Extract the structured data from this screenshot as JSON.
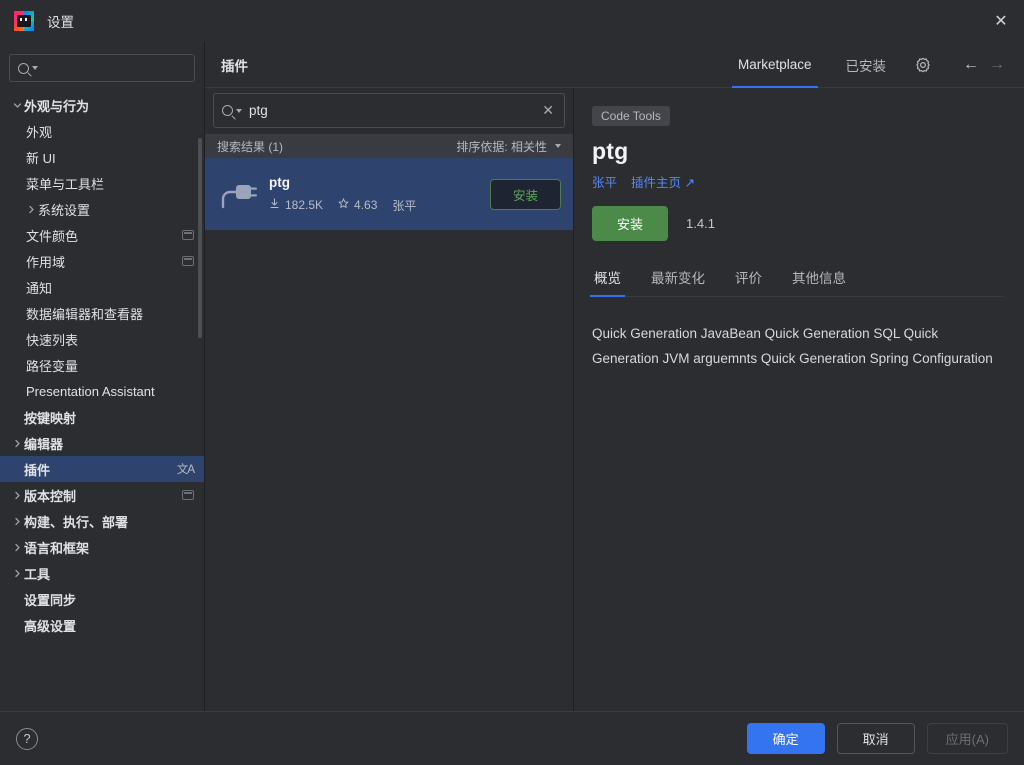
{
  "window": {
    "title": "设置",
    "logo_icon": "intellij-idea-logo",
    "close_icon": "close-icon"
  },
  "sidebar": {
    "search": {
      "value": "",
      "placeholder": "",
      "icon": "search-icon",
      "dropdown_icon": "chevron-down-icon"
    },
    "items": [
      {
        "label": "外观与行为",
        "level": 0,
        "arrow": "expanded",
        "selected": false,
        "badge": null
      },
      {
        "label": "外观",
        "level": 1,
        "arrow": null,
        "selected": false,
        "badge": null
      },
      {
        "label": "新 UI",
        "level": 1,
        "arrow": null,
        "selected": false,
        "badge": null
      },
      {
        "label": "菜单与工具栏",
        "level": 1,
        "arrow": null,
        "selected": false,
        "badge": null
      },
      {
        "label": "系统设置",
        "level": 1,
        "arrow": "collapsed",
        "selected": false,
        "badge": null
      },
      {
        "label": "文件颜色",
        "level": 1,
        "arrow": null,
        "selected": false,
        "badge": "project-icon"
      },
      {
        "label": "作用域",
        "level": 1,
        "arrow": null,
        "selected": false,
        "badge": "project-icon"
      },
      {
        "label": "通知",
        "level": 1,
        "arrow": null,
        "selected": false,
        "badge": null
      },
      {
        "label": "数据编辑器和查看器",
        "level": 1,
        "arrow": null,
        "selected": false,
        "badge": null
      },
      {
        "label": "快速列表",
        "level": 1,
        "arrow": null,
        "selected": false,
        "badge": null
      },
      {
        "label": "路径变量",
        "level": 1,
        "arrow": null,
        "selected": false,
        "badge": null
      },
      {
        "label": "Presentation Assistant",
        "level": 1,
        "arrow": null,
        "selected": false,
        "badge": null
      },
      {
        "label": "按键映射",
        "level": 0,
        "arrow": null,
        "selected": false,
        "badge": null
      },
      {
        "label": "编辑器",
        "level": 0,
        "arrow": "collapsed",
        "selected": false,
        "badge": null
      },
      {
        "label": "插件",
        "level": 0,
        "arrow": null,
        "selected": true,
        "badge": "translate-icon"
      },
      {
        "label": "版本控制",
        "level": 0,
        "arrow": "collapsed",
        "selected": false,
        "badge": "project-icon"
      },
      {
        "label": "构建、执行、部署",
        "level": 0,
        "arrow": "collapsed",
        "selected": false,
        "badge": null
      },
      {
        "label": "语言和框架",
        "level": 0,
        "arrow": "collapsed",
        "selected": false,
        "badge": null
      },
      {
        "label": "工具",
        "level": 0,
        "arrow": "collapsed",
        "selected": false,
        "badge": null
      },
      {
        "label": "设置同步",
        "level": 0,
        "arrow": null,
        "selected": false,
        "badge": null
      },
      {
        "label": "高级设置",
        "level": 0,
        "arrow": null,
        "selected": false,
        "badge": null
      }
    ]
  },
  "plugins": {
    "title": "插件",
    "tabs": [
      {
        "label": "Marketplace",
        "active": true
      },
      {
        "label": "已安装",
        "active": false
      }
    ],
    "gear_icon": "gear-icon",
    "nav": {
      "back_icon": "arrow-left-icon",
      "forward_icon": "arrow-right-icon"
    },
    "search": {
      "value": "ptg",
      "placeholder": "",
      "icon": "search-icon",
      "dropdown_icon": "chevron-down-icon",
      "clear_icon": "clear-icon"
    },
    "results_label": "搜索结果 (1)",
    "sort_label": "排序依据: 相关性",
    "sort_icon": "chevron-down-icon",
    "list": [
      {
        "icon": "plug-icon",
        "name": "ptg",
        "downloads_icon": "download-icon",
        "downloads": "182.5K",
        "rating_icon": "star-icon",
        "rating": "4.63",
        "author": "张平",
        "install_label": "安装",
        "selected": true
      }
    ]
  },
  "detail": {
    "tag": "Code Tools",
    "title": "ptg",
    "author_link": "张平",
    "homepage_link": "插件主页",
    "homepage_icon": "external-link-icon",
    "install_label": "安装",
    "version": "1.4.1",
    "tabs": [
      {
        "label": "概览",
        "active": true
      },
      {
        "label": "最新变化",
        "active": false
      },
      {
        "label": "评价",
        "active": false
      },
      {
        "label": "其他信息",
        "active": false
      }
    ],
    "description": "Quick Generation JavaBean Quick Generation SQL Quick Generation JVM arguemnts Quick Generation Spring Configuration"
  },
  "footer": {
    "help_icon": "help-icon",
    "help_label": "?",
    "ok_label": "确定",
    "cancel_label": "取消",
    "apply_label": "应用(A)"
  },
  "colors": {
    "accent_blue": "#3574f0",
    "selection_blue": "#2e436e",
    "install_green": "#4c8a4a",
    "link_blue": "#548af7",
    "bg": "#2b2d30"
  }
}
